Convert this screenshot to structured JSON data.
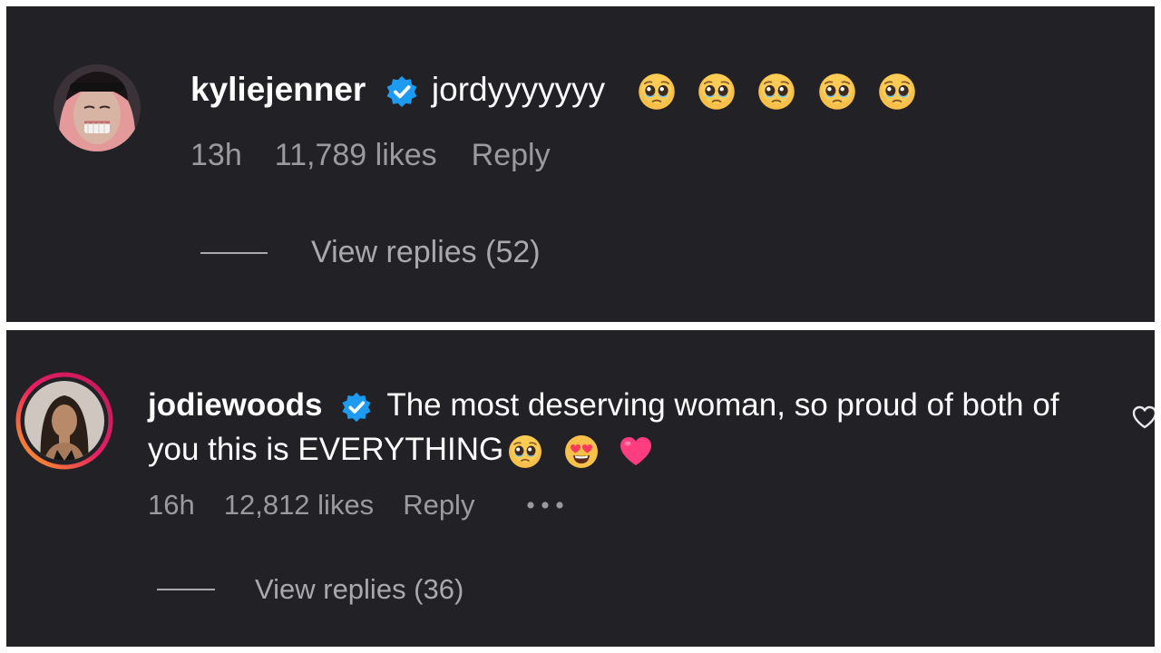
{
  "comments": [
    {
      "username": "kyliejenner",
      "text": "jordyyyyyyy",
      "time": "13h",
      "likes": "11,789 likes",
      "reply_label": "Reply",
      "view_replies": "View replies (52)"
    },
    {
      "username": "jodiewoods",
      "text": "The most deserving woman, so proud of both of you this is EVERYTHING",
      "time": "16h",
      "likes": "12,812 likes",
      "reply_label": "Reply",
      "view_replies": "View replies (36)"
    }
  ],
  "icons": {
    "verified": "verified-badge-icon",
    "pleading": "pleading-face-emoji",
    "heart_eyes": "star-struck-emoji",
    "heart": "pink-heart-emoji",
    "more": "more-options-icon",
    "like": "heart-outline-icon"
  },
  "colors": {
    "background": "#212126",
    "verified": "#1d9bf0",
    "text": "#ffffff",
    "meta": "#9a9aa0"
  }
}
